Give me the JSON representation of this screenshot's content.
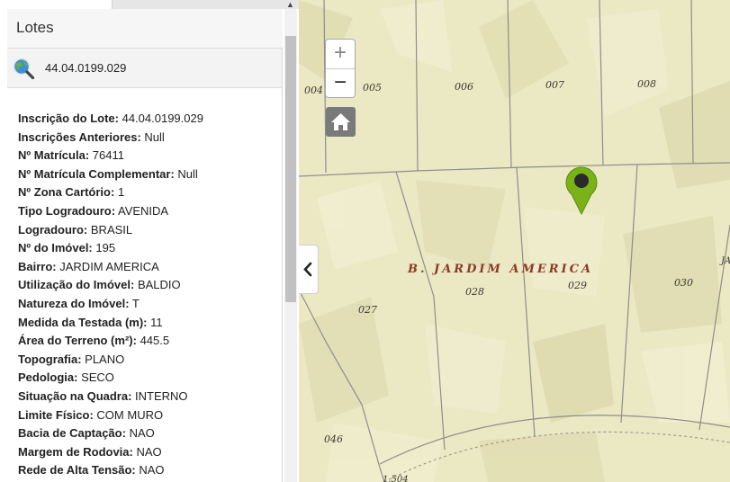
{
  "panel": {
    "title": "Lotes",
    "lot_id": "44.04.0199.029",
    "attributes": [
      {
        "label": "Inscrição do Lote:",
        "value": "44.04.0199.029"
      },
      {
        "label": "Inscrições Anteriores:",
        "value": "Null"
      },
      {
        "label": "Nº Matrícula:",
        "value": "76411"
      },
      {
        "label": "Nº Matrícula Complementar:",
        "value": "Null"
      },
      {
        "label": "Nº Zona Cartório:",
        "value": "1"
      },
      {
        "label": "Tipo Logradouro:",
        "value": "AVENIDA"
      },
      {
        "label": "Logradouro:",
        "value": "BRASIL"
      },
      {
        "label": "Nº do Imóvel:",
        "value": "195"
      },
      {
        "label": "Bairro:",
        "value": "JARDIM AMERICA"
      },
      {
        "label": "Utilização do Imóvel:",
        "value": "BALDIO"
      },
      {
        "label": "Natureza do Imóvel:",
        "value": "T"
      },
      {
        "label": "Medida da Testada (m):",
        "value": "11"
      },
      {
        "label": "Área do Terreno (m²):",
        "value": "445.5"
      },
      {
        "label": "Topografia:",
        "value": "PLANO"
      },
      {
        "label": "Pedologia:",
        "value": "SECO"
      },
      {
        "label": "Situação na Quadra:",
        "value": "INTERNO"
      },
      {
        "label": "Limite Físico:",
        "value": "COM MURO"
      },
      {
        "label": "Bacia de Captação:",
        "value": "NAO"
      },
      {
        "label": "Margem de Rodovia:",
        "value": "NAO"
      },
      {
        "label": "Rede de Alta Tensão:",
        "value": "NAO"
      }
    ]
  },
  "map": {
    "zoom_in": "+",
    "zoom_out": "−",
    "home_icon": "home-icon",
    "collapse_icon": "chevron-left-icon",
    "marker_icon": "map-marker-icon",
    "marker_color": "#7ab317",
    "neighborhood_label": "B. JARDIM AMERICA",
    "neighborhood_cut": "JA",
    "lot_labels": [
      "004",
      "005",
      "006",
      "007",
      "008",
      "027",
      "028",
      "029",
      "030",
      "046"
    ],
    "street_number": "1.504"
  },
  "colors": {
    "terrain": "#ebe8c4",
    "lot_lines": "#8e8e8a",
    "label_red": "#8a3a26"
  }
}
